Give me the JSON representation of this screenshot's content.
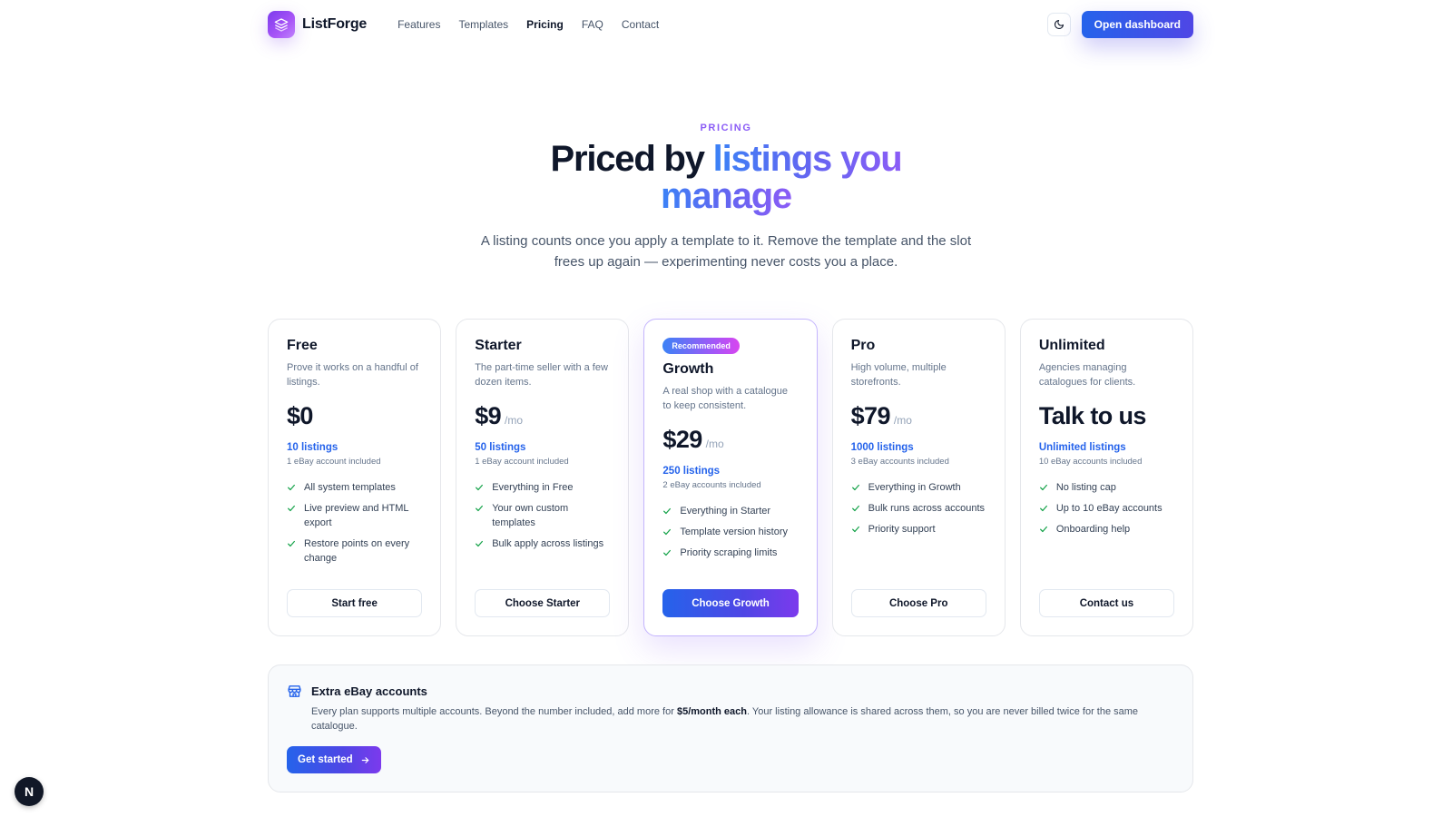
{
  "brand": {
    "name": "ListForge"
  },
  "nav": {
    "links": [
      "Features",
      "Templates",
      "Pricing",
      "FAQ",
      "Contact"
    ],
    "active": "Pricing",
    "cta": "Open dashboard"
  },
  "hero": {
    "eyebrow": "PRICING",
    "title_plain": "Priced by ",
    "title_gradient_1": "listings you",
    "title_gradient_2": "manage",
    "subtitle": "A listing counts once you apply a template to it. Remove the template and the slot frees up again — experimenting never costs you a place."
  },
  "plans": [
    {
      "name": "Free",
      "description": "Prove it works on a handful of listings.",
      "price": "$0",
      "period": "",
      "listings": "10 listings",
      "accounts": "1 eBay account included",
      "features": [
        "All system templates",
        "Live preview and HTML export",
        "Restore points on every change"
      ],
      "button": "Start free"
    },
    {
      "name": "Starter",
      "description": "The part-time seller with a few dozen items.",
      "price": "$9",
      "period": "/mo",
      "listings": "50 listings",
      "accounts": "1 eBay account included",
      "features": [
        "Everything in Free",
        "Your own custom templates",
        "Bulk apply across listings"
      ],
      "button": "Choose Starter"
    },
    {
      "name": "Growth",
      "badge": "Recommended",
      "description": "A real shop with a catalogue to keep consistent.",
      "price": "$29",
      "period": "/mo",
      "listings": "250 listings",
      "accounts": "2 eBay accounts included",
      "features": [
        "Everything in Starter",
        "Template version history",
        "Priority scraping limits"
      ],
      "button": "Choose Growth"
    },
    {
      "name": "Pro",
      "description": "High volume, multiple storefronts.",
      "price": "$79",
      "period": "/mo",
      "listings": "1000 listings",
      "accounts": "3 eBay accounts included",
      "features": [
        "Everything in Growth",
        "Bulk runs across accounts",
        "Priority support"
      ],
      "button": "Choose Pro"
    },
    {
      "name": "Unlimited",
      "description": "Agencies managing catalogues for clients.",
      "price": "Talk to us",
      "period": "",
      "listings": "Unlimited listings",
      "accounts": "10 eBay accounts included",
      "features": [
        "No listing cap",
        "Up to 10 eBay accounts",
        "Onboarding help"
      ],
      "button": "Contact us"
    }
  ],
  "extra": {
    "title": "Extra eBay accounts",
    "text_before": "Every plan supports multiple accounts. Beyond the number included, add more for ",
    "text_bold": "$5/month each",
    "text_after": ". Your listing allowance is shared across them, so you are never billed twice for the same catalogue.",
    "button": "Get started"
  },
  "floating_badge": "N",
  "colors": {
    "accent": "#4f46e5",
    "link": "#2563eb",
    "check": "#16a34a",
    "eyebrow": "#8b5cf6"
  }
}
